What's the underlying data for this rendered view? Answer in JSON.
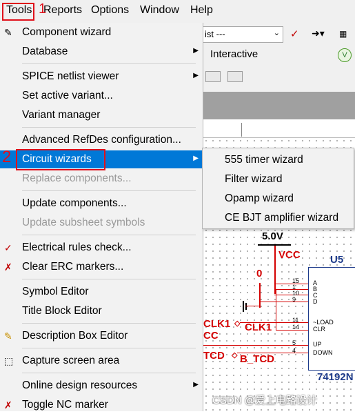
{
  "menubar": {
    "items": [
      {
        "label": "Tools"
      },
      {
        "label": "Reports"
      },
      {
        "label": "Options"
      },
      {
        "label": "Window"
      },
      {
        "label": "Help"
      }
    ]
  },
  "annotations": {
    "one": "1",
    "two": "2"
  },
  "toolbar": {
    "combo_value": "ist ---",
    "interactive_label": "Interactive"
  },
  "tools_menu": {
    "items": [
      {
        "label": "Component wizard",
        "icon": "component-wizard-icon"
      },
      {
        "label": "Database",
        "submenu": true
      },
      {
        "label": "SPICE netlist viewer",
        "submenu": true
      },
      {
        "label": "Set active variant..."
      },
      {
        "label": "Variant manager"
      },
      {
        "label": "Advanced RefDes configuration..."
      },
      {
        "label": "Circuit wizards",
        "submenu": true,
        "highlighted": true
      },
      {
        "label": "Replace components...",
        "disabled": true
      },
      {
        "label": "Update components..."
      },
      {
        "label": "Update subsheet symbols",
        "disabled": true
      },
      {
        "label": "Electrical rules check...",
        "icon": "erc-icon"
      },
      {
        "label": "Clear ERC markers...",
        "icon": "clear-erc-icon"
      },
      {
        "label": "Symbol Editor"
      },
      {
        "label": "Title Block Editor"
      },
      {
        "label": "Description Box Editor",
        "icon": "description-box-icon"
      },
      {
        "label": "Capture screen area",
        "icon": "capture-area-icon"
      },
      {
        "label": "Online design resources",
        "submenu": true
      },
      {
        "label": "Toggle NC marker",
        "icon": "nc-marker-icon"
      }
    ]
  },
  "circuit_wizards_submenu": {
    "items": [
      {
        "label": "555 timer wizard"
      },
      {
        "label": "Filter wizard"
      },
      {
        "label": "Opamp wizard"
      },
      {
        "label": "CE BJT amplifier wizard"
      }
    ]
  },
  "schematic": {
    "voltage": "5.0V",
    "vcc": "VCC",
    "zero": "0",
    "u5": "U5",
    "clk1_left": "CLK1",
    "cc": "CC",
    "clk1_right": "CLK1",
    "tcd": "TCD",
    "b_tcd": "B_TCD",
    "part": "74192N",
    "pins": [
      "15",
      "1",
      "10",
      "9",
      "11",
      "14",
      "5",
      "4"
    ],
    "pin_names": [
      "A",
      "B",
      "C",
      "D",
      "~LOAD",
      "CLR",
      "UP",
      "DOWN"
    ]
  },
  "watermark": "CSDN @爱上电路设计",
  "colors": {
    "highlight": "#0078d7",
    "annotation": "#e0101a",
    "net_red": "#d40000",
    "part_blue": "#1c3a8a"
  }
}
